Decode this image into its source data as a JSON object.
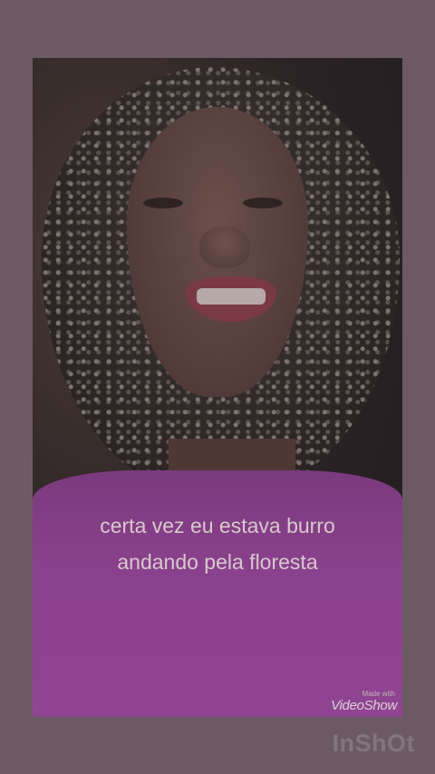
{
  "caption": {
    "line1": "certa vez eu estava burro",
    "line2": "andando pela floresta"
  },
  "watermarks": {
    "videoshow_made_with": "Made with",
    "videoshow_logo": "VideoShow",
    "inshot_logo": "InShOt"
  },
  "colors": {
    "page_background": "#6b5a63",
    "shirt": "#8a418d",
    "caption_text": "#d8c9cd"
  }
}
